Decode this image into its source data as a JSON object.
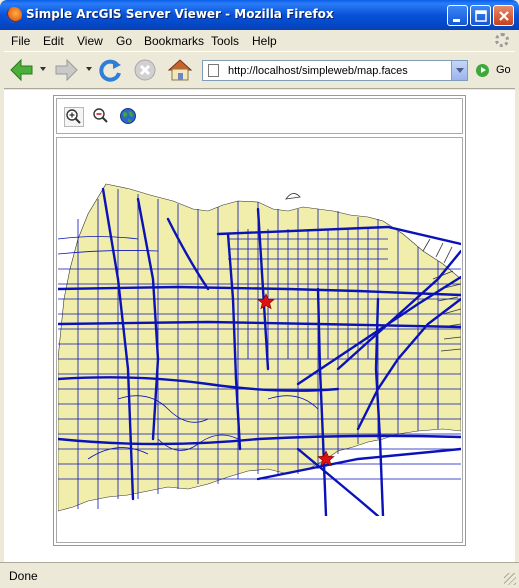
{
  "window": {
    "title": "Simple ArcGIS Server Viewer - Mozilla Firefox"
  },
  "menu": {
    "items": [
      {
        "label": "File"
      },
      {
        "label": "Edit"
      },
      {
        "label": "View"
      },
      {
        "label": "Go"
      },
      {
        "label": "Bookmarks"
      },
      {
        "label": "Tools"
      },
      {
        "label": "Help"
      }
    ]
  },
  "nav": {
    "url": "http://localhost/simpleweb/map.faces",
    "go_label": "Go",
    "icons": [
      "back-icon",
      "forward-icon",
      "reload-icon",
      "stop-icon",
      "home-icon"
    ]
  },
  "map_toolbar": {
    "tools": [
      "zoom-in-icon",
      "zoom-out-icon",
      "full-extent-globe-icon"
    ]
  },
  "map": {
    "land_color": "#f0eeaa",
    "street_color": "#0a12b8",
    "marker_color": "#dd1111",
    "markers": [
      "star-marker",
      "star-marker"
    ]
  },
  "status": {
    "text": "Done"
  },
  "colors": {
    "titlebar": "#0852d8",
    "chrome": "#ece9d8"
  }
}
